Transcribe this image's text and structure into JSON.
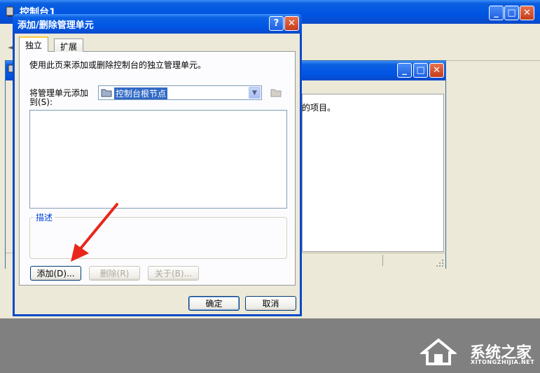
{
  "background_window": {
    "title": "控制台1",
    "pane_text_fragment": "的项目。"
  },
  "dialog": {
    "title": "添加/删除管理单元",
    "tabs": [
      {
        "label": "独立",
        "active": true
      },
      {
        "label": "扩展",
        "active": false
      }
    ],
    "description": "使用此页来添加或删除控制台的独立管理单元。",
    "add_to_label_line1": "将管理单元添加",
    "add_to_label_line2": "到(S):",
    "add_to_value": "控制台根节点",
    "group_label": "描述",
    "buttons": {
      "add": "添加(D)...",
      "remove": "删除(R)",
      "about": "关于(B)...",
      "ok": "确定",
      "cancel": "取消"
    }
  },
  "watermark": {
    "name": "系统之家",
    "url": "XITONGZHIJIA.NET"
  },
  "colors": {
    "titlebar": "#0054e3",
    "annotation_arrow": "#e8261c",
    "selection": "#316ac5"
  }
}
